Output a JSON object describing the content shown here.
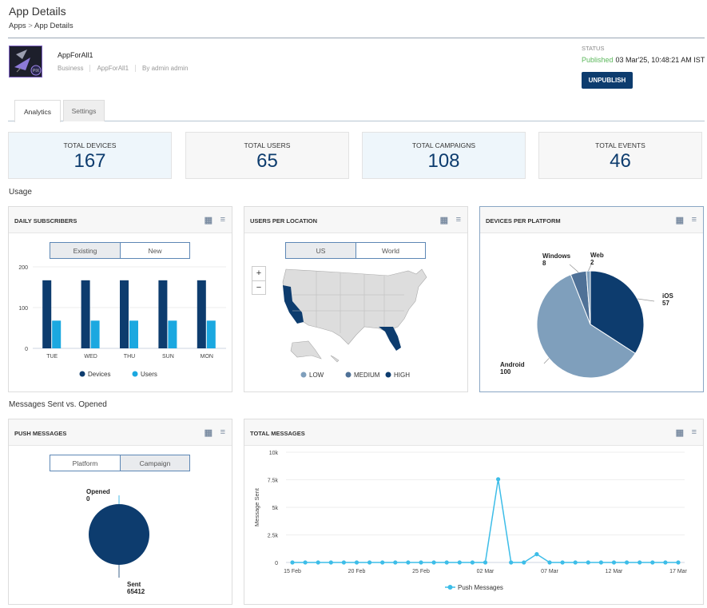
{
  "header": {
    "title": "App Details",
    "breadcrumb": [
      "Apps",
      "App Details"
    ],
    "breadcrumb_sep": ">"
  },
  "app": {
    "name": "AppForAll1",
    "category": "Business",
    "bundle": "AppForAll1",
    "owner": "By admin admin",
    "logo_badge": "PIX"
  },
  "status": {
    "label": "STATUS",
    "value": "Published",
    "timestamp": "03 Mar'25, 10:48:21 AM IST",
    "unpublish_label": "UNPUBLISH"
  },
  "tabs": [
    {
      "label": "Analytics",
      "active": true
    },
    {
      "label": "Settings",
      "active": false
    }
  ],
  "summary": [
    {
      "label": "TOTAL DEVICES",
      "value": "167"
    },
    {
      "label": "TOTAL USERS",
      "value": "65"
    },
    {
      "label": "TOTAL CAMPAIGNS",
      "value": "108"
    },
    {
      "label": "TOTAL EVENTS",
      "value": "46"
    }
  ],
  "sections": {
    "usage": "Usage",
    "messages": "Messages Sent vs. Opened"
  },
  "icons": {
    "table": "table-icon",
    "menu": "menu-icon"
  },
  "colors": {
    "primary": "#0d3c6e",
    "accent": "#1ba8e0",
    "android": "#7f9fbc",
    "windows": "#4f7197",
    "line": "#3dbde8",
    "published": "#5cb85c"
  },
  "daily_subscribers": {
    "title": "DAILY SUBSCRIBERS",
    "toggle": [
      "Existing",
      "New"
    ],
    "active_toggle": "Existing"
  },
  "users_per_location": {
    "title": "USERS PER LOCATION",
    "toggle": [
      "US",
      "World"
    ],
    "active_toggle": "US",
    "zoom_in": "+",
    "zoom_out": "−",
    "legend": [
      {
        "label": "LOW",
        "color": "#7f9fbc"
      },
      {
        "label": "MEDIUM",
        "color": "#4f7197"
      },
      {
        "label": "HIGH",
        "color": "#0d3c6e"
      }
    ],
    "highlighted_states": [
      "California",
      "Florida"
    ]
  },
  "devices_per_platform": {
    "title": "DEVICES PER PLATFORM"
  },
  "push_messages": {
    "title": "PUSH MESSAGES",
    "toggle": [
      "Platform",
      "Campaign"
    ],
    "active_toggle": "Campaign"
  },
  "total_messages": {
    "title": "TOTAL MESSAGES"
  },
  "chart_data": [
    {
      "type": "bar",
      "categories": [
        "TUE",
        "WED",
        "THU",
        "SUN",
        "MON"
      ],
      "series": [
        {
          "name": "Devices",
          "values": [
            167,
            167,
            167,
            167,
            167
          ],
          "color": "#0d3c6e"
        },
        {
          "name": "Users",
          "values": [
            68,
            68,
            68,
            68,
            68
          ],
          "color": "#1ba8e0"
        }
      ],
      "yticks": [
        0,
        100,
        200
      ],
      "ylim": [
        0,
        200
      ],
      "grid": true,
      "legend": "bottom"
    },
    {
      "type": "pie",
      "slices": [
        {
          "label": "iOS",
          "value": 57,
          "color": "#0d3c6e"
        },
        {
          "label": "Android",
          "value": 100,
          "color": "#7f9fbc"
        },
        {
          "label": "Windows",
          "value": 8,
          "color": "#4f7197"
        },
        {
          "label": "Web",
          "value": 2,
          "color": "#7f9fbc"
        }
      ]
    },
    {
      "type": "pie",
      "slices": [
        {
          "label": "Opened",
          "value": 0,
          "color": "#1ba8e0"
        },
        {
          "label": "Sent",
          "value": 65412,
          "color": "#0d3c6e"
        }
      ]
    },
    {
      "type": "line",
      "ylabel": "Message Sent",
      "ylim": [
        0,
        10000
      ],
      "yticks": [
        "0",
        "2.5k",
        "5k",
        "7.5k",
        "10k"
      ],
      "xticks": [
        "15 Feb",
        "20 Feb",
        "25 Feb",
        "02 Mar",
        "07 Mar",
        "12 Mar",
        "17 Mar"
      ],
      "x": [
        "15 Feb",
        "16 Feb",
        "17 Feb",
        "18 Feb",
        "19 Feb",
        "20 Feb",
        "21 Feb",
        "22 Feb",
        "23 Feb",
        "24 Feb",
        "25 Feb",
        "26 Feb",
        "27 Feb",
        "28 Feb",
        "01 Mar",
        "02 Mar",
        "03 Mar",
        "04 Mar",
        "05 Mar",
        "06 Mar",
        "07 Mar",
        "08 Mar",
        "09 Mar",
        "10 Mar",
        "11 Mar",
        "12 Mar",
        "13 Mar",
        "14 Mar",
        "15 Mar",
        "16 Mar",
        "17 Mar"
      ],
      "series": [
        {
          "name": "Push Messages",
          "values": [
            0,
            0,
            0,
            0,
            0,
            0,
            0,
            0,
            0,
            0,
            0,
            0,
            0,
            0,
            0,
            0,
            7550,
            0,
            0,
            750,
            0,
            0,
            0,
            0,
            0,
            0,
            0,
            0,
            0,
            0,
            0
          ]
        }
      ],
      "grid": true,
      "legend": "bottom"
    }
  ]
}
